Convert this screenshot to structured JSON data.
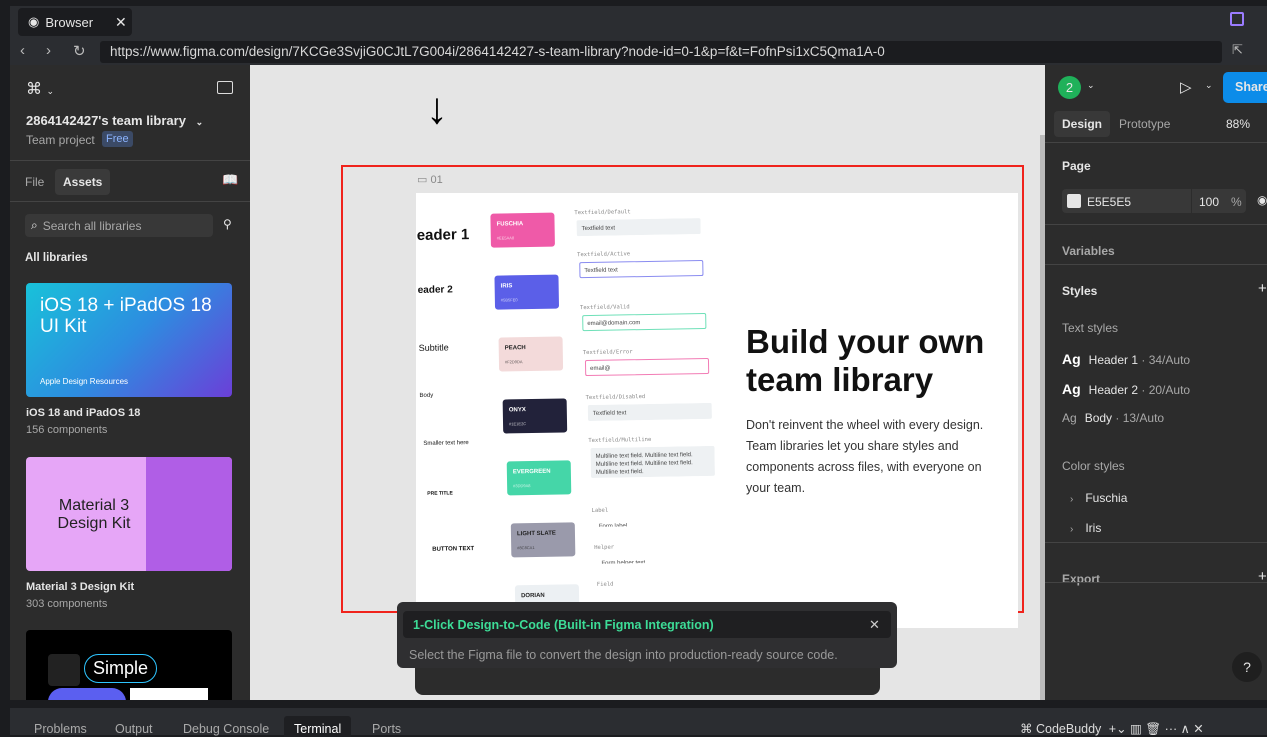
{
  "browser": {
    "tab_label": "Browser",
    "url": "https://www.figma.com/design/7KCGe3SvjiG0CJtL7G004i/2864142427-s-team-library?node-id=0-1&p=f&t=FofnPsi1xC5Qma1A-0"
  },
  "left_panel": {
    "project_title": "2864142427's team library",
    "project_type": "Team project",
    "plan_badge": "Free",
    "tabs": [
      "File",
      "Assets"
    ],
    "search_placeholder": "Search all libraries",
    "section_title": "All libraries",
    "libraries": [
      {
        "thumb_title": "iOS 18 + iPadOS 18 UI Kit",
        "thumb_caption": "Apple Design Resources",
        "name": "iOS 18 and iPadOS 18",
        "count": "156 components"
      },
      {
        "thumb_title": "Material 3 Design Kit",
        "name": "Material 3 Design Kit",
        "count": "303 components"
      },
      {
        "thumb_title": "Simple"
      }
    ]
  },
  "canvas": {
    "frame_label": "01",
    "headline": "Build your own team library",
    "body": "Don't reinvent the wheel with every design. Team libraries let you share styles and components across files, with everyone on your team.",
    "type_samples": [
      "eader 1",
      "eader 2",
      "Subtitle",
      "Body",
      "Smaller text here",
      "PRE TITLE",
      "BUTTON TEXT"
    ],
    "swatches": [
      {
        "name": "FUSCHIA",
        "hex": "#EE5AA8",
        "color": "#ef5aa8"
      },
      {
        "name": "IRIS",
        "hex": "#5B5FE0",
        "color": "#5b5fe8"
      },
      {
        "name": "PEACH",
        "hex": "#F2D9DA",
        "color": "#f3dada"
      },
      {
        "name": "ONYX",
        "hex": "#1E1E2C",
        "color": "#22223a"
      },
      {
        "name": "EVERGREEN",
        "hex": "#3DD9A8",
        "color": "#45d6a8"
      },
      {
        "name": "LIGHT SLATE",
        "hex": "#8C8CA1",
        "color": "#9a9aab"
      },
      {
        "name": "DORIAN",
        "hex": "#ECF1F4",
        "color": "#ecf0f3"
      }
    ],
    "fields": [
      {
        "label": "Textfield/Default",
        "value": "Textfield text"
      },
      {
        "label": "Textfield/Active",
        "value": "Textfield text"
      },
      {
        "label": "Textfield/Valid",
        "value": "email@domain.com"
      },
      {
        "label": "Textfield/Error",
        "value": "email@"
      },
      {
        "label": "Textfield/Disabled",
        "value": "Textfield text"
      },
      {
        "label": "Textfield/Multiline",
        "value": "Multiline text field. Multiline text field. Multiline text field. Multiline text field. Multiline text field."
      },
      {
        "label": "Label",
        "value": "Form label"
      },
      {
        "label": "Helper",
        "value": "Form helper text"
      },
      {
        "label": "Field",
        "value": ""
      }
    ]
  },
  "toast": {
    "title": "1-Click Design-to-Code (Built-in Figma Integration)",
    "message": "Select the Figma file to convert the design into production-ready source code."
  },
  "right_panel": {
    "avatar": "2",
    "share": "Share",
    "tabs": [
      "Design",
      "Prototype"
    ],
    "zoom": "88%",
    "page_title": "Page",
    "page_color": "E5E5E5",
    "page_opacity": "100",
    "percent": "%",
    "variables": "Variables",
    "styles": "Styles",
    "text_styles_title": "Text styles",
    "text_styles": [
      {
        "name": "Header 1",
        "spec": " · 34/Auto"
      },
      {
        "name": "Header 2",
        "spec": " · 20/Auto"
      },
      {
        "name": "Body",
        "spec": " · 13/Auto"
      }
    ],
    "color_styles_title": "Color styles",
    "color_styles": [
      "Fuschia",
      "Iris"
    ],
    "export": "Export",
    "help": "?"
  },
  "bottom_panel": {
    "tabs": [
      "Problems",
      "Output",
      "Debug Console",
      "Terminal",
      "Ports"
    ],
    "active": "Terminal",
    "codebuddy": "CodeBuddy"
  }
}
